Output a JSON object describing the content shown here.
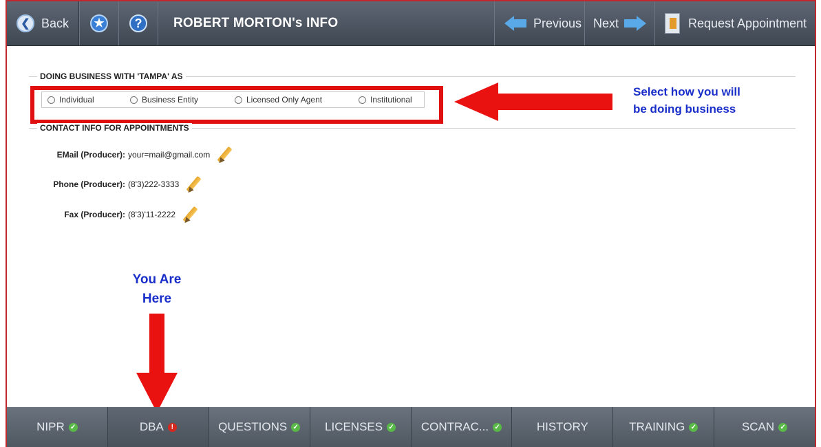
{
  "header": {
    "back_label": "Back",
    "title": "ROBERT MORTON's INFO",
    "previous_label": "Previous",
    "next_label": "Next",
    "request_label": "Request Appointment"
  },
  "dba_section": {
    "heading": "DOING BUSINESS WITH 'TAMPA' AS",
    "options": [
      "Individual",
      "Business Entity",
      "Licensed Only Agent",
      "Institutional"
    ]
  },
  "contact_section": {
    "heading": "CONTACT INFO FOR APPOINTMENTS",
    "rows": [
      {
        "label": "EMail (Producer):",
        "value": "your=mail@gmail.com"
      },
      {
        "label": "Phone (Producer):",
        "value": "(8'3)222-3333"
      },
      {
        "label": "Fax (Producer):",
        "value": "(8'3)'11-2222"
      }
    ]
  },
  "annotations": {
    "select_line1": "Select how you will",
    "select_line2": "be doing business",
    "here_line1": "You Are",
    "here_line2": "Here"
  },
  "tabs": [
    {
      "label": "NIPR",
      "status": "check"
    },
    {
      "label": "DBA",
      "status": "warn"
    },
    {
      "label": "QUESTIONS",
      "status": "check"
    },
    {
      "label": "LICENSES",
      "status": "check"
    },
    {
      "label": "CONTRAC...",
      "status": "check"
    },
    {
      "label": "HISTORY",
      "status": "none"
    },
    {
      "label": "TRAINING",
      "status": "check"
    },
    {
      "label": "SCAN",
      "status": "check"
    }
  ],
  "colors": {
    "annotation_red": "#ea1111",
    "annotation_blue": "#1a2fc9",
    "bar": "#4f5761"
  }
}
